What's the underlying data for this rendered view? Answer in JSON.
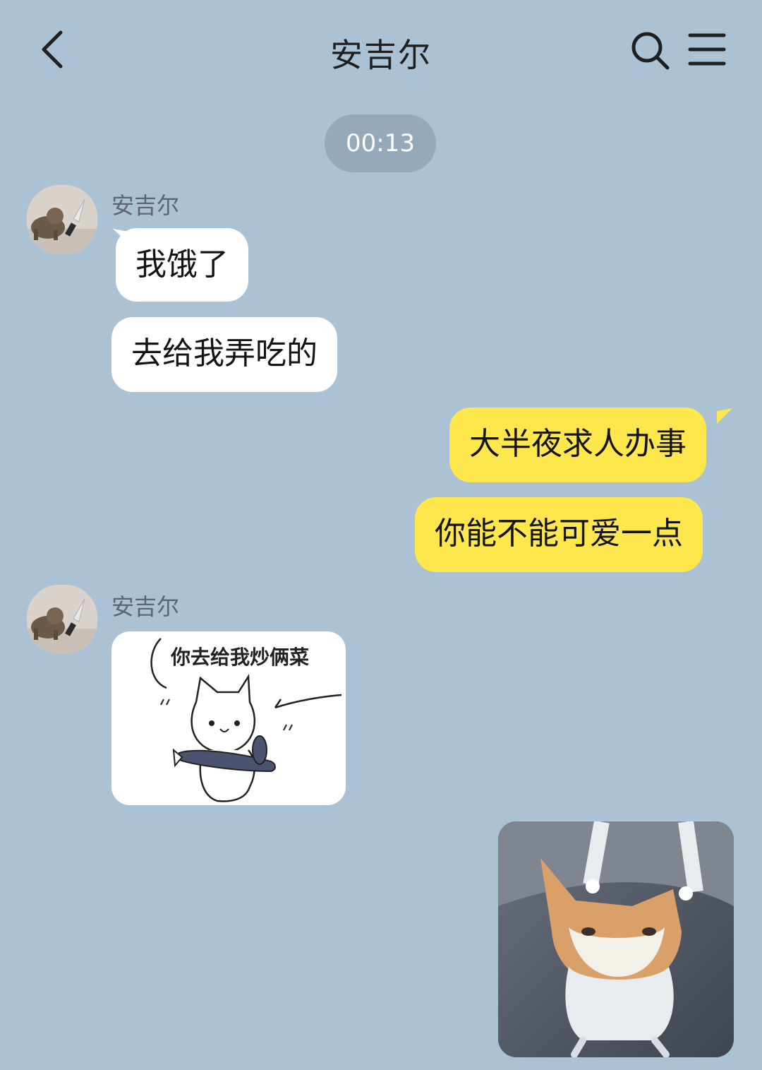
{
  "header": {
    "title": "安吉尔",
    "back_icon": "chevron-left-icon",
    "search_icon": "search-icon",
    "menu_icon": "menu-icon"
  },
  "time_divider": "00:13",
  "messages": [
    {
      "sender": "安吉尔",
      "direction": "incoming",
      "text": "我饿了"
    },
    {
      "direction": "incoming",
      "text": "去给我弄吃的"
    },
    {
      "direction": "outgoing",
      "text": "大半夜求人办事"
    },
    {
      "direction": "outgoing",
      "text": "你能不能可爱一点"
    },
    {
      "sender": "安吉尔",
      "direction": "incoming",
      "type": "sticker",
      "caption": "你去给我炒俩菜"
    },
    {
      "direction": "outgoing",
      "type": "sticker"
    }
  ],
  "colors": {
    "background": "#abc1d4",
    "incoming_bubble": "#ffffff",
    "outgoing_bubble": "#fde74c",
    "time_pill": "#95a9ba"
  }
}
